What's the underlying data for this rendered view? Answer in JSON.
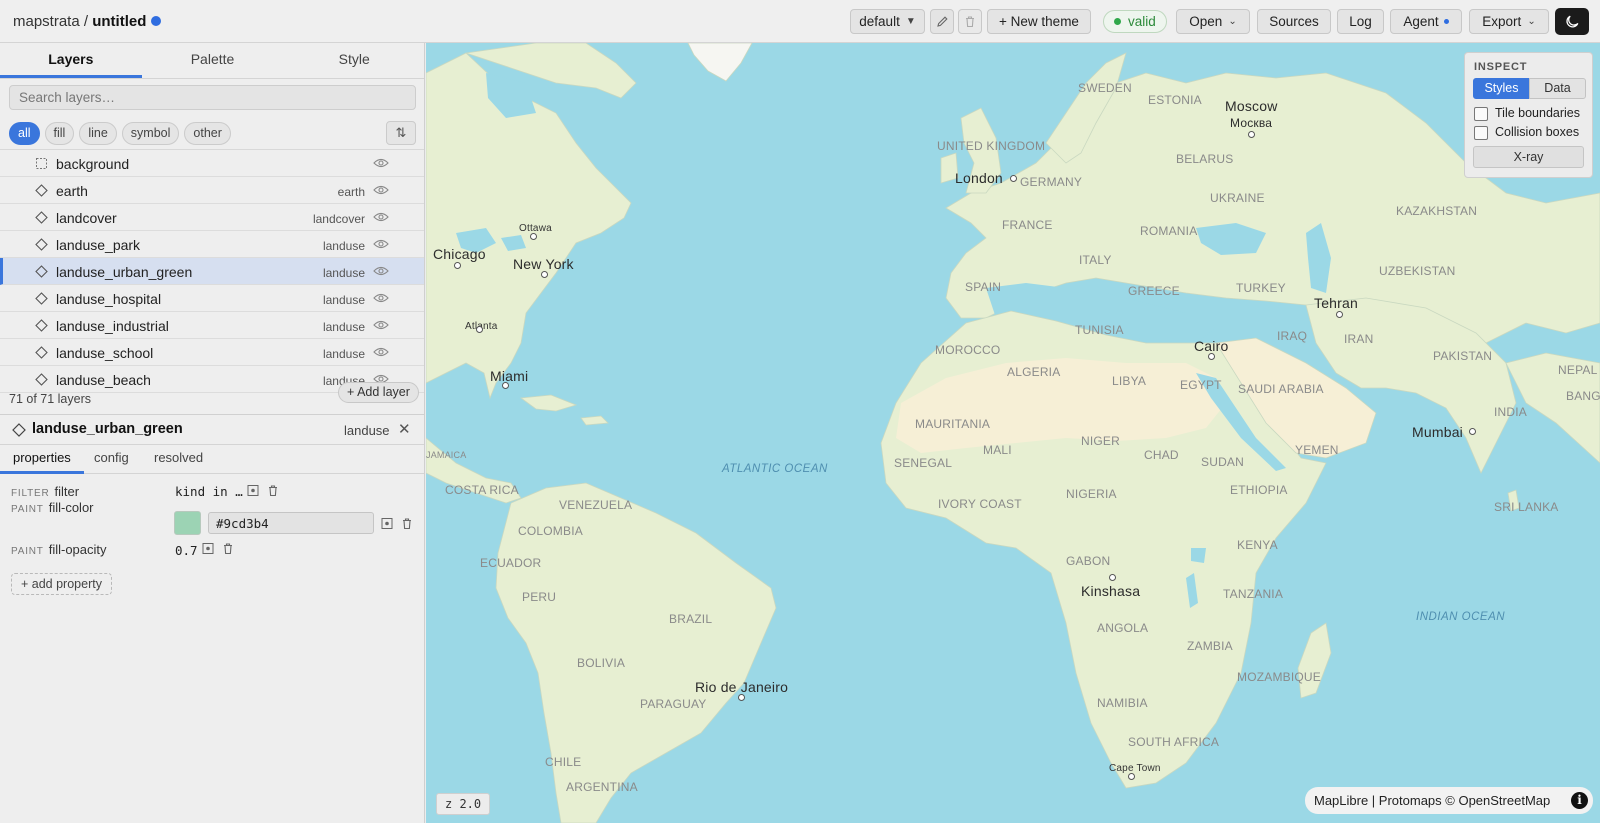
{
  "header": {
    "project": "mapstrata",
    "separator": " / ",
    "file": "untitled",
    "theme_select": "default",
    "new_theme": "+ New theme",
    "status": "valid",
    "open": "Open",
    "sources": "Sources",
    "log": "Log",
    "agent": "Agent",
    "export": "Export"
  },
  "sidebar": {
    "tabs": [
      "Layers",
      "Palette",
      "Style"
    ],
    "search_placeholder": "Search layers…",
    "filters": [
      "all",
      "fill",
      "line",
      "symbol",
      "other"
    ],
    "sort_icon": "⇅",
    "layers": [
      {
        "name": "background",
        "source": "",
        "type": "background"
      },
      {
        "name": "earth",
        "source": "earth",
        "type": "fill"
      },
      {
        "name": "landcover",
        "source": "landcover",
        "type": "fill"
      },
      {
        "name": "landuse_park",
        "source": "landuse",
        "type": "fill"
      },
      {
        "name": "landuse_urban_green",
        "source": "landuse",
        "type": "fill",
        "selected": true
      },
      {
        "name": "landuse_hospital",
        "source": "landuse",
        "type": "fill"
      },
      {
        "name": "landuse_industrial",
        "source": "landuse",
        "type": "fill"
      },
      {
        "name": "landuse_school",
        "source": "landuse",
        "type": "fill"
      },
      {
        "name": "landuse_beach",
        "source": "landuse",
        "type": "fill"
      }
    ],
    "layer_count": "71 of 71 layers",
    "add_layer": "+ Add layer"
  },
  "detail": {
    "layer_name": "landuse_urban_green",
    "source": "landuse",
    "close": "✕",
    "tabs": [
      "properties",
      "config",
      "resolved"
    ],
    "properties": [
      {
        "kind": "FILTER",
        "name": "filter",
        "value": "kind in …"
      },
      {
        "kind": "PAINT",
        "name": "fill-color",
        "value": "#9cd3b4"
      },
      {
        "kind": "PAINT",
        "name": "fill-opacity",
        "value": "0.7"
      }
    ],
    "add_property": "+ add property",
    "swatch_color": "#9cd3b4"
  },
  "map": {
    "countries": [
      "SWEDEN",
      "ESTONIA",
      "BELARUS",
      "UKRAINE",
      "UNITED KINGDOM",
      "GERMANY",
      "FRANCE",
      "ROMANIA",
      "KAZAKHSTAN",
      "ITALY",
      "SPAIN",
      "GREECE",
      "TURKEY",
      "UZBEKISTAN",
      "TUNISIA",
      "MOROCCO",
      "ALGERIA",
      "LIBYA",
      "EGYPT",
      "IRAQ",
      "IRAN",
      "SAUDI ARABIA",
      "PAKISTAN",
      "NEPAL",
      "INDIA",
      "BANGLAD",
      "MAURITANIA",
      "MALI",
      "NIGER",
      "CHAD",
      "SUDAN",
      "YEMEN",
      "SENEGAL",
      "IVORY COAST",
      "NIGERIA",
      "ETHIOPIA",
      "SRI LANKA",
      "KENYA",
      "GABON",
      "TANZANIA",
      "ANGOLA",
      "ZAMBIA",
      "MOZAMBIQUE",
      "NAMIBIA",
      "SOUTH AFRICA",
      "JAMAICA",
      "COSTA RICA",
      "VENEZUELA",
      "COLOMBIA",
      "ECUADOR",
      "PERU",
      "BRAZIL",
      "BOLIVIA",
      "PARAGUAY",
      "CHILE",
      "ARGENTINA"
    ],
    "cities": [
      "Moscow",
      "Москва",
      "London",
      "Tehran",
      "Cairo",
      "Mumbai",
      "Kinshasa",
      "Rio de Janeiro",
      "Chicago",
      "New York",
      "Miami",
      "Ottawa",
      "Atlanta",
      "Cape Town"
    ],
    "oceans": [
      "ATLANTIC OCEAN",
      "INDIAN OCEAN"
    ],
    "water_color": "#9bd8e6",
    "land_color": "#e7efd2",
    "desert_color": "#f6efd6"
  },
  "inspect": {
    "title": "INSPECT",
    "modes": [
      "Styles",
      "Data"
    ],
    "options": [
      "Tile boundaries",
      "Collision boxes"
    ],
    "xray": "X-ray"
  },
  "zoom_label": "z 2.0",
  "attribution": "MapLibre | Protomaps © OpenStreetMap",
  "attribution_icon": "i",
  "colors": {
    "accent": "#3a76dc",
    "valid": "#2fa84a"
  }
}
